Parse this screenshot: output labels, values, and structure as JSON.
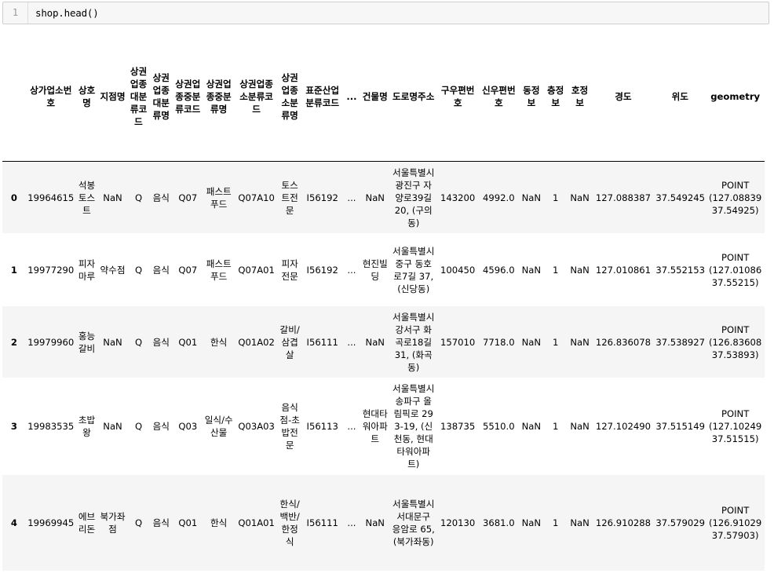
{
  "cell": {
    "line_number": "1",
    "code": "shop.head()"
  },
  "table": {
    "columns": [
      "",
      "상가업소번호",
      "상호명",
      "지점명",
      "상권업종대분류코드",
      "상권업종대분류명",
      "상권업종중분류코드",
      "상권업종중분류명",
      "상권업종소분류코드",
      "상권업종소분류명",
      "표준산업분류코드",
      "...",
      "건물명",
      "도로명주소",
      "구우편번호",
      "신우편번호",
      "동정보",
      "층정보",
      "호정보",
      "경도",
      "위도",
      "geometry"
    ],
    "rows": [
      [
        "0",
        "19964615",
        "석봉토스트",
        "NaN",
        "Q",
        "음식",
        "Q07",
        "패스트푸드",
        "Q07A10",
        "토스트전문",
        "I56192",
        "...",
        "NaN",
        "서울특별시 광진구 자양로39길 20, (구의동)",
        "143200",
        "4992.0",
        "NaN",
        "1",
        "NaN",
        "127.088387",
        "37.549245",
        "POINT (127.08839 37.54925)"
      ],
      [
        "1",
        "19977290",
        "피자마루",
        "약수점",
        "Q",
        "음식",
        "Q07",
        "패스트푸드",
        "Q07A01",
        "피자전문",
        "I56192",
        "...",
        "현진빌딩",
        "서울특별시 중구 동호로7길 37, (신당동)",
        "100450",
        "4596.0",
        "NaN",
        "1",
        "NaN",
        "127.010861",
        "37.552153",
        "POINT (127.01086 37.55215)"
      ],
      [
        "2",
        "19979960",
        "홍능갈비",
        "NaN",
        "Q",
        "음식",
        "Q01",
        "한식",
        "Q01A02",
        "갈비/삼겹살",
        "I56111",
        "...",
        "NaN",
        "서울특별시 강서구 화곡로18길 31, (화곡동)",
        "157010",
        "7718.0",
        "NaN",
        "1",
        "NaN",
        "126.836078",
        "37.538927",
        "POINT (126.83608 37.53893)"
      ],
      [
        "3",
        "19983535",
        "초밥왕",
        "NaN",
        "Q",
        "음식",
        "Q03",
        "일식/수산물",
        "Q03A03",
        "음식점-초밥전문",
        "I56113",
        "...",
        "현대타워아파트",
        "서울특별시 송파구 올림픽로 293-19, (신천동, 현대타워아파트)",
        "138735",
        "5510.0",
        "NaN",
        "1",
        "NaN",
        "127.102490",
        "37.515149",
        "POINT (127.10249 37.51515)"
      ],
      [
        "4",
        "19969945",
        "에브리돈",
        "북가좌점",
        "Q",
        "음식",
        "Q01",
        "한식",
        "Q01A01",
        "한식/백반/한정식",
        "I56111",
        "...",
        "NaN",
        "서울특별시 서대문구 응암로 65, (북가좌동)",
        "120130",
        "3681.0",
        "NaN",
        "1",
        "NaN",
        "126.910288",
        "37.579029",
        "POINT (126.91029 37.57903)"
      ]
    ]
  }
}
